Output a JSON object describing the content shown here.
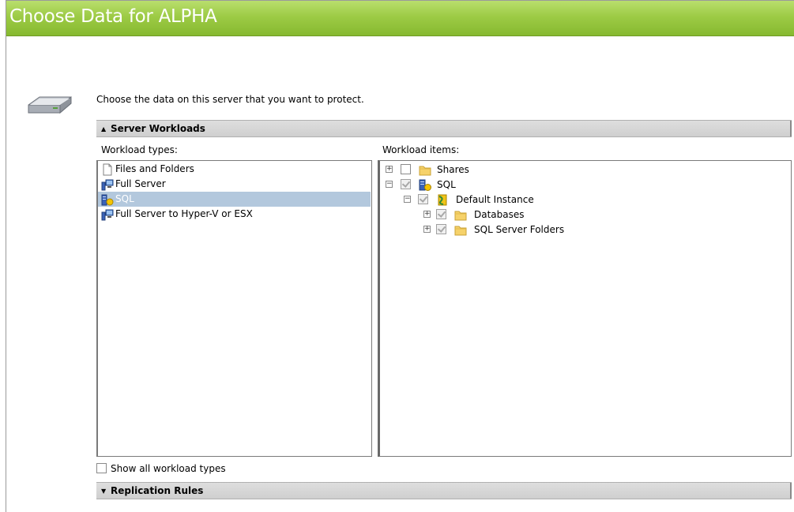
{
  "page": {
    "title": "Choose Data for ALPHA",
    "intro": "Choose the data on this server that you want to protect."
  },
  "server_workloads": {
    "label": "Server Workloads",
    "expanded": true,
    "types_label": "Workload types:",
    "items_label": "Workload items:",
    "workload_types": [
      {
        "label": "Files and Folders",
        "icon": "document-icon",
        "selected": false
      },
      {
        "label": "Full Server",
        "icon": "server-icon",
        "selected": false
      },
      {
        "label": "SQL",
        "icon": "sql-server-icon",
        "selected": true
      },
      {
        "label": "Full Server to Hyper-V or ESX",
        "icon": "server-icon",
        "selected": false
      }
    ],
    "workload_items": [
      {
        "label": "Shares",
        "icon": "folder-icon",
        "expander": "plus",
        "checked": false
      },
      {
        "label": "SQL",
        "icon": "sql-server-icon",
        "expander": "minus",
        "checked": true
      },
      {
        "label": "Default Instance",
        "icon": "sql-instance-icon",
        "expander": "minus",
        "checked": true
      },
      {
        "label": "Databases",
        "icon": "folder-icon",
        "expander": "plus",
        "checked": true
      },
      {
        "label": "SQL Server Folders",
        "icon": "folder-icon",
        "expander": "plus",
        "checked": true
      }
    ],
    "show_all_label": "Show all workload types",
    "show_all_checked": false
  },
  "replication_rules": {
    "label": "Replication Rules",
    "expanded": false
  },
  "colors": {
    "header_green": "#9dcb45",
    "selection": "#b3c8dd",
    "section_bar": "#d6d6d6"
  }
}
